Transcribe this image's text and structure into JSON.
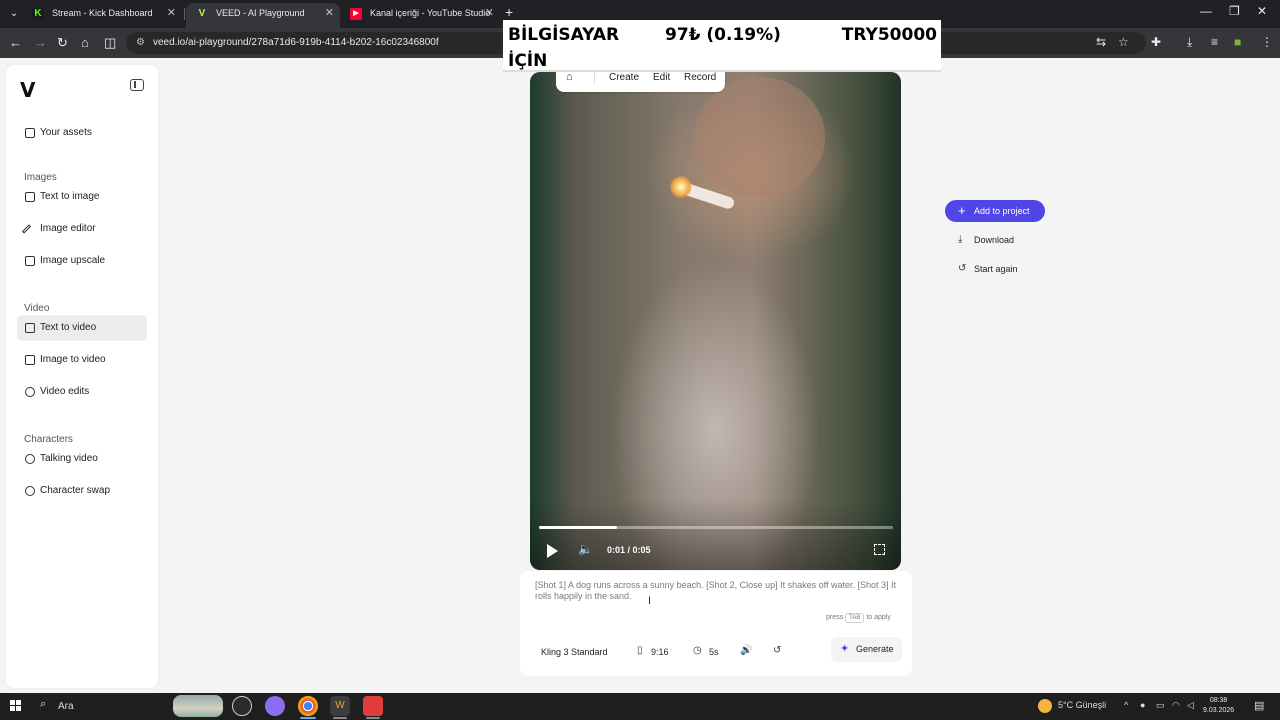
{
  "browser": {
    "tabs": [
      {
        "title": "Stream - Kick Dashboard",
        "favicon": "K",
        "color": "#53fc18"
      },
      {
        "title": "VEED - AI Playground",
        "favicon": "V",
        "color": "#b6f24b"
      },
      {
        "title": "Kanal içeriği - YouTube Studio",
        "favicon": "▶",
        "color": "#ff0033"
      }
    ],
    "url": "veed.io/ai-playground/278a71d6-919b-4114-b202-16c02346800f"
  },
  "ticker": {
    "line1": "BİLGİSAYAR",
    "line2": "İÇİN",
    "amount": "97₺ (0.19%)",
    "goal": "TRY50000"
  },
  "top_nav": {
    "items": [
      "Create",
      "Edit",
      "Record"
    ]
  },
  "sidebar": {
    "logo": "V",
    "assets_label": "Your assets",
    "sections": [
      {
        "title": "Images",
        "items": [
          "Text to image",
          "Image editor",
          "Image upscale"
        ]
      },
      {
        "title": "Video",
        "items": [
          "Text to video",
          "Image to video",
          "Video edits"
        ]
      },
      {
        "title": "Characters",
        "items": [
          "Talking video",
          "Character swap"
        ]
      }
    ],
    "active_item": "Text to video"
  },
  "player": {
    "time": "0:01 / 0:05",
    "progress": 0.22
  },
  "actions": {
    "add_to_project": "Add to project",
    "download": "Download",
    "start_again": "Start again"
  },
  "prompt": {
    "text": "[Shot 1] A dog runs across a sunny beach. [Shot 2, Close up] It shakes off water. [Shot 3] It rolls happily in the sand.",
    "hint_press": "press",
    "hint_key": "TAB",
    "hint_apply": "to apply",
    "model": "Kling 3 Standard",
    "aspect": "9:16",
    "duration": "5s",
    "generate": "Generate"
  },
  "taskbar": {
    "search": "Ara",
    "weather": "5°C Güneşli",
    "time": "08:38",
    "date": "9.03.2026"
  }
}
